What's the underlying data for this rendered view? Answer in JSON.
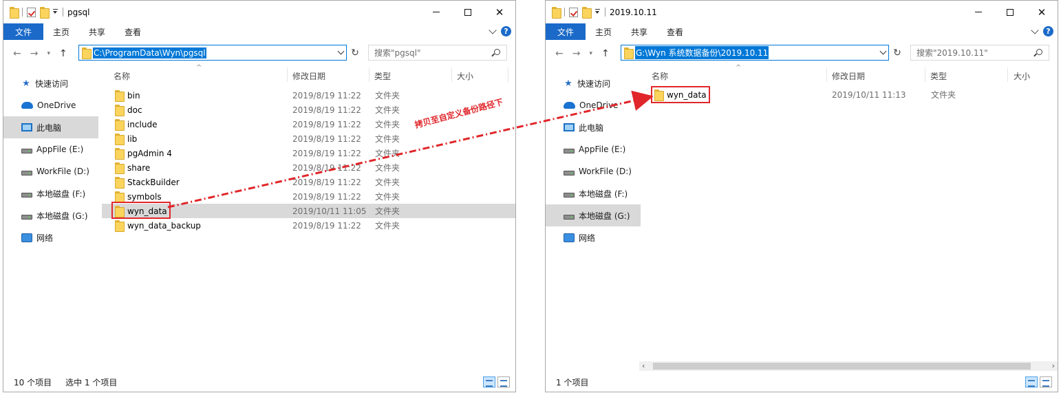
{
  "left": {
    "title": "pgsql",
    "ribbon": {
      "file": "文件",
      "home": "主页",
      "share": "共享",
      "view": "查看"
    },
    "address": "C:\\ProgramData\\Wyn\\pgsql",
    "search_placeholder": "搜索\"pgsql\"",
    "columns": {
      "name": "名称",
      "date": "修改日期",
      "type": "类型",
      "size": "大小"
    },
    "nav": [
      "快速访问",
      "OneDrive",
      "此电脑",
      "AppFile (E:)",
      "WorkFile (D:)",
      "本地磁盘 (F:)",
      "本地磁盘 (G:)",
      "网络"
    ],
    "files": [
      {
        "name": "bin",
        "date": "2019/8/19 11:22",
        "type": "文件夹"
      },
      {
        "name": "doc",
        "date": "2019/8/19 11:22",
        "type": "文件夹"
      },
      {
        "name": "include",
        "date": "2019/8/19 11:22",
        "type": "文件夹"
      },
      {
        "name": "lib",
        "date": "2019/8/19 11:22",
        "type": "文件夹"
      },
      {
        "name": "pgAdmin 4",
        "date": "2019/8/19 11:22",
        "type": "文件夹"
      },
      {
        "name": "share",
        "date": "2019/8/19 11:22",
        "type": "文件夹"
      },
      {
        "name": "StackBuilder",
        "date": "2019/8/19 11:22",
        "type": "文件夹"
      },
      {
        "name": "symbols",
        "date": "2019/8/19 11:22",
        "type": "文件夹"
      },
      {
        "name": "wyn_data",
        "date": "2019/10/11 11:05",
        "type": "文件夹"
      },
      {
        "name": "wyn_data_backup",
        "date": "2019/8/19 11:22",
        "type": "文件夹"
      }
    ],
    "status_count": "10 个项目",
    "status_selected": "选中 1 个项目"
  },
  "right": {
    "title": "2019.10.11",
    "ribbon": {
      "file": "文件",
      "home": "主页",
      "share": "共享",
      "view": "查看"
    },
    "address": "G:\\Wyn 系统数据备份\\2019.10.11",
    "search_placeholder": "搜索\"2019.10.11\"",
    "columns": {
      "name": "名称",
      "date": "修改日期",
      "type": "类型",
      "size": "大小"
    },
    "nav": [
      "快速访问",
      "OneDrive",
      "此电脑",
      "AppFile (E:)",
      "WorkFile (D:)",
      "本地磁盘 (F:)",
      "本地磁盘 (G:)",
      "网络"
    ],
    "files": [
      {
        "name": "wyn_data",
        "date": "2019/10/11 11:13",
        "type": "文件夹"
      }
    ],
    "status_count": "1 个项目"
  },
  "annotation": "拷贝至自定义备份路径下",
  "colors": {
    "accent": "#1b6ac9",
    "highlight": "#e0262a",
    "selection": "#d9d9d9"
  }
}
